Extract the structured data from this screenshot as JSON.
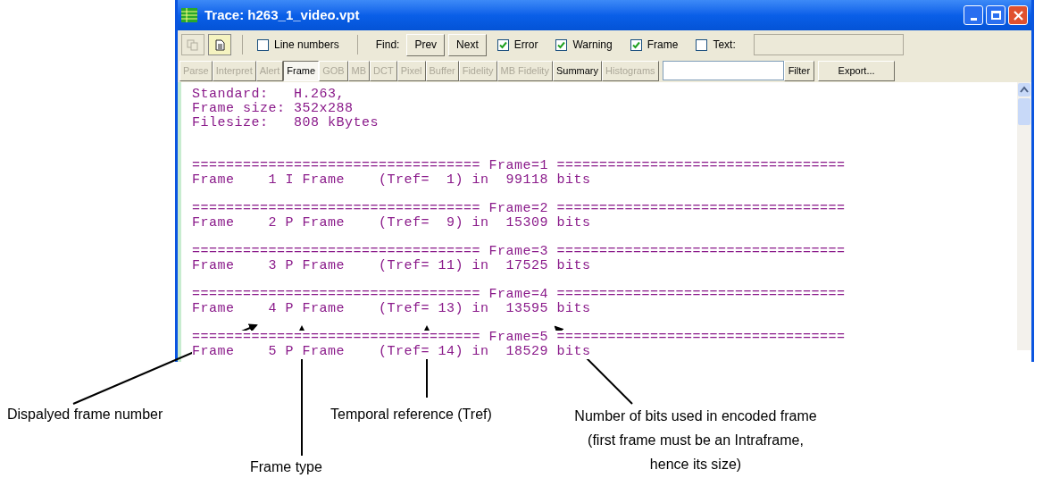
{
  "window": {
    "title": "Trace: h263_1_video.vpt"
  },
  "toolbar": {
    "line_numbers": {
      "label": "Line numbers",
      "checked": false
    },
    "find_label": "Find:",
    "buttons": [
      "Prev",
      "Next"
    ],
    "filters": [
      {
        "label": "Error",
        "checked": true
      },
      {
        "label": "Warning",
        "checked": true
      },
      {
        "label": "Frame",
        "checked": true
      },
      {
        "label": "Text:",
        "checked": false
      }
    ]
  },
  "tabs": [
    {
      "label": "Parse",
      "selected": false,
      "disabled": true
    },
    {
      "label": "Interpret",
      "selected": false,
      "disabled": true
    },
    {
      "label": "Alert",
      "selected": false,
      "disabled": true
    },
    {
      "label": "Frame",
      "selected": true,
      "disabled": false
    },
    {
      "label": "GOB",
      "selected": false,
      "disabled": true
    },
    {
      "label": "MB",
      "selected": false,
      "disabled": true
    },
    {
      "label": "DCT",
      "selected": false,
      "disabled": true
    },
    {
      "label": "Pixel",
      "selected": false,
      "disabled": true
    },
    {
      "label": "Buffer",
      "selected": false,
      "disabled": true
    },
    {
      "label": "Fidelity",
      "selected": false,
      "disabled": true
    },
    {
      "label": "MB Fidelity",
      "selected": false,
      "disabled": true
    },
    {
      "label": "Summary",
      "selected": false,
      "disabled": false
    },
    {
      "label": "Histograms",
      "selected": false,
      "disabled": true
    }
  ],
  "filter_button": "Filter",
  "export_button": "Export...",
  "trace_lines": [
    {
      "kind": "text",
      "text": "Standard:   H.263,"
    },
    {
      "kind": "text",
      "text": "Frame size: 352x288"
    },
    {
      "kind": "text",
      "text": "Filesize:   808 kBytes"
    },
    {
      "kind": "blank"
    },
    {
      "kind": "blank"
    },
    {
      "kind": "text",
      "text": "================================== Frame=1 =================================="
    },
    {
      "kind": "text",
      "text": "Frame    1 I Frame    (Tref=  1) in  99118 bits"
    },
    {
      "kind": "blank"
    },
    {
      "kind": "text",
      "text": "================================== Frame=2 =================================="
    },
    {
      "kind": "text",
      "text": "Frame    2 P Frame    (Tref=  9) in  15309 bits"
    },
    {
      "kind": "blank"
    },
    {
      "kind": "text",
      "text": "================================== Frame=3 =================================="
    },
    {
      "kind": "text",
      "text": "Frame    3 P Frame    (Tref= 11) in  17525 bits"
    },
    {
      "kind": "blank"
    },
    {
      "kind": "text",
      "text": "================================== Frame=4 =================================="
    },
    {
      "kind": "text",
      "text": "Frame    4 P Frame    (Tref= 13) in  13595 bits"
    },
    {
      "kind": "blank"
    },
    {
      "kind": "text",
      "text": "================================== Frame=5 =================================="
    },
    {
      "kind": "text",
      "text": "Frame    5 P Frame    (Tref= 14) in  18529 bits"
    }
  ],
  "annotations": [
    "Dispalyed frame number",
    "Frame type",
    "Temporal reference (Tref)",
    "Number of bits used in encoded frame (first frame must be an Intraframe, hence its size)"
  ]
}
